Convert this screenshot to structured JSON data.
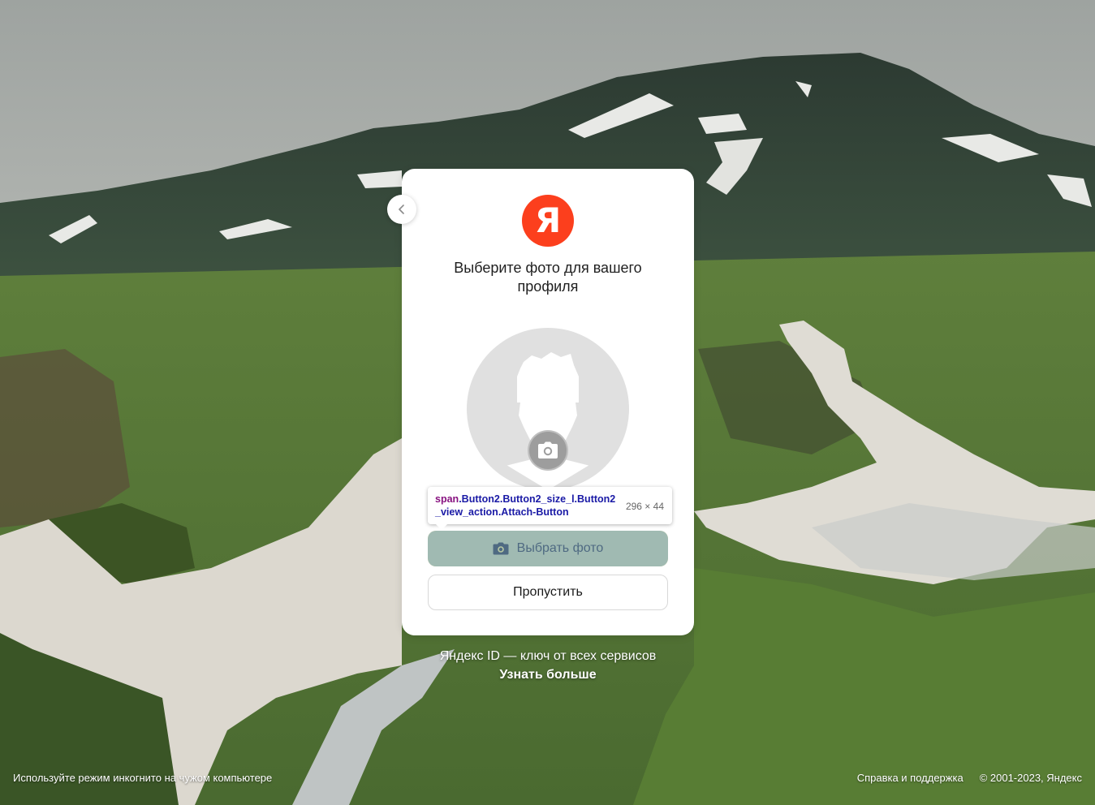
{
  "card": {
    "logo_letter": "Я",
    "title": "Выберите фото для вашего профиля",
    "choose_button_label": "Выбрать фото",
    "skip_button_label": "Пропустить"
  },
  "devtools_tooltip": {
    "selector_tag": "span",
    "selector_classes": ".Button2.Button2_size_l.Button2_view_action.Attach-Button",
    "dimensions": "296 × 44"
  },
  "promo": {
    "tagline": "Яндекс ID — ключ от всех сервисов",
    "learn_more": "Узнать больше"
  },
  "footer": {
    "incognito_hint": "Используйте режим инкогнито на чужом компьютере",
    "help_link": "Справка и поддержка",
    "copyright": "© 2001-2023, Яндекс"
  },
  "colors": {
    "brand_red": "#fc3f1d",
    "action_yellow": "#ffdc60",
    "devtools_highlight": "#6fa8dc"
  }
}
